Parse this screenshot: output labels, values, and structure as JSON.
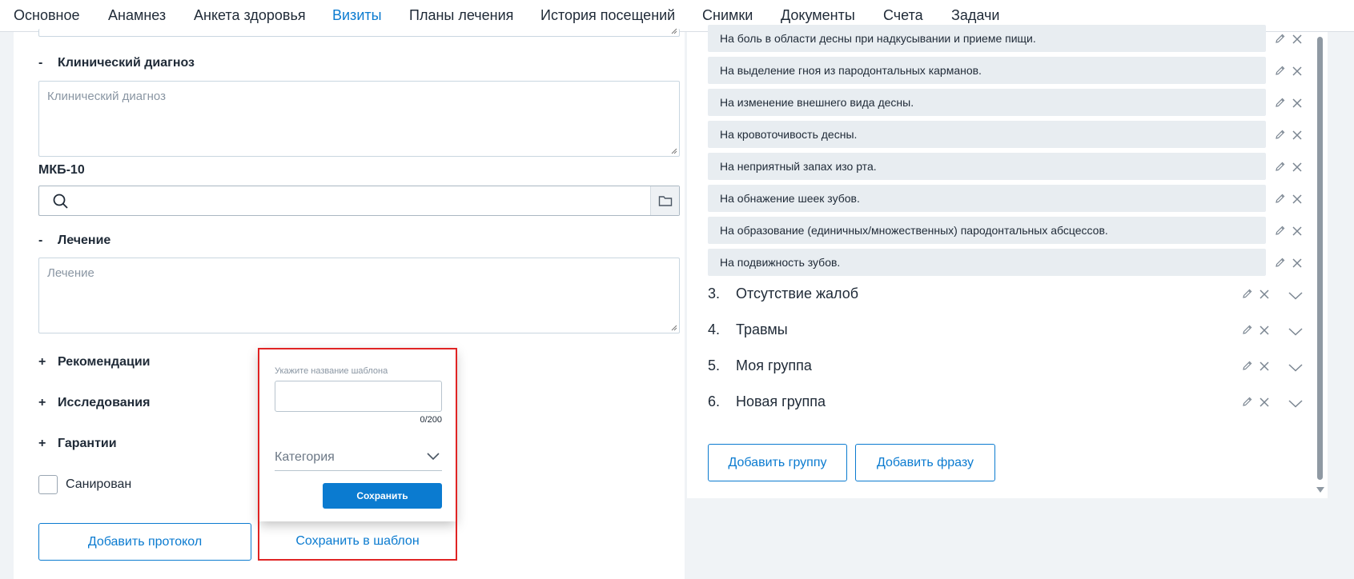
{
  "tabs": [
    "Основное",
    "Анамнез",
    "Анкета здоровья",
    "Визиты",
    "Планы лечения",
    "История посещений",
    "Снимки",
    "Документы",
    "Счета",
    "Задачи"
  ],
  "active_tab": "Визиты",
  "left": {
    "clinical_diagnosis": {
      "sign": "-",
      "title": "Клинический диагноз",
      "placeholder": "Клинический диагноз"
    },
    "mkb_label": "МКБ-10",
    "treatment": {
      "sign": "-",
      "title": "Лечение",
      "placeholder": "Лечение"
    },
    "recommendations": {
      "sign": "+",
      "title": "Рекомендации"
    },
    "research": {
      "sign": "+",
      "title": "Исследования"
    },
    "guarantees": {
      "sign": "+",
      "title": "Гарантии"
    },
    "sanitized_label": "Санирован",
    "add_protocol": "Добавить протокол",
    "save_template": "Сохранить в шаблон"
  },
  "popup": {
    "name_label": "Укажите название шаблона",
    "counter": "0/200",
    "category_placeholder": "Категория",
    "save": "Сохранить"
  },
  "right": {
    "phrases": [
      "На боль в области десны при надкусывании и приеме пищи.",
      "На выделение гноя из пародонтальных карманов.",
      "На изменение внешнего вида десны.",
      "На кровоточивость десны.",
      "На неприятный запах изо рта.",
      "На обнажение шеек зубов.",
      "На образование (единичных/множественных) пародонтальных абсцессов.",
      "На подвижность зубов."
    ],
    "groups": [
      {
        "num": "3.",
        "name": "Отсутствие жалоб"
      },
      {
        "num": "4.",
        "name": "Травмы"
      },
      {
        "num": "5.",
        "name": "Моя группа"
      },
      {
        "num": "6.",
        "name": "Новая группа"
      }
    ],
    "add_group": "Добавить группу",
    "add_phrase": "Добавить фразу"
  },
  "icons": {
    "search": "search-icon",
    "folder": "folder-icon",
    "edit": "pencil-icon",
    "delete": "close-icon",
    "expand": "chevron-down-icon"
  },
  "colors": {
    "accent": "#0b7bd0",
    "highlight": "#e02424"
  }
}
